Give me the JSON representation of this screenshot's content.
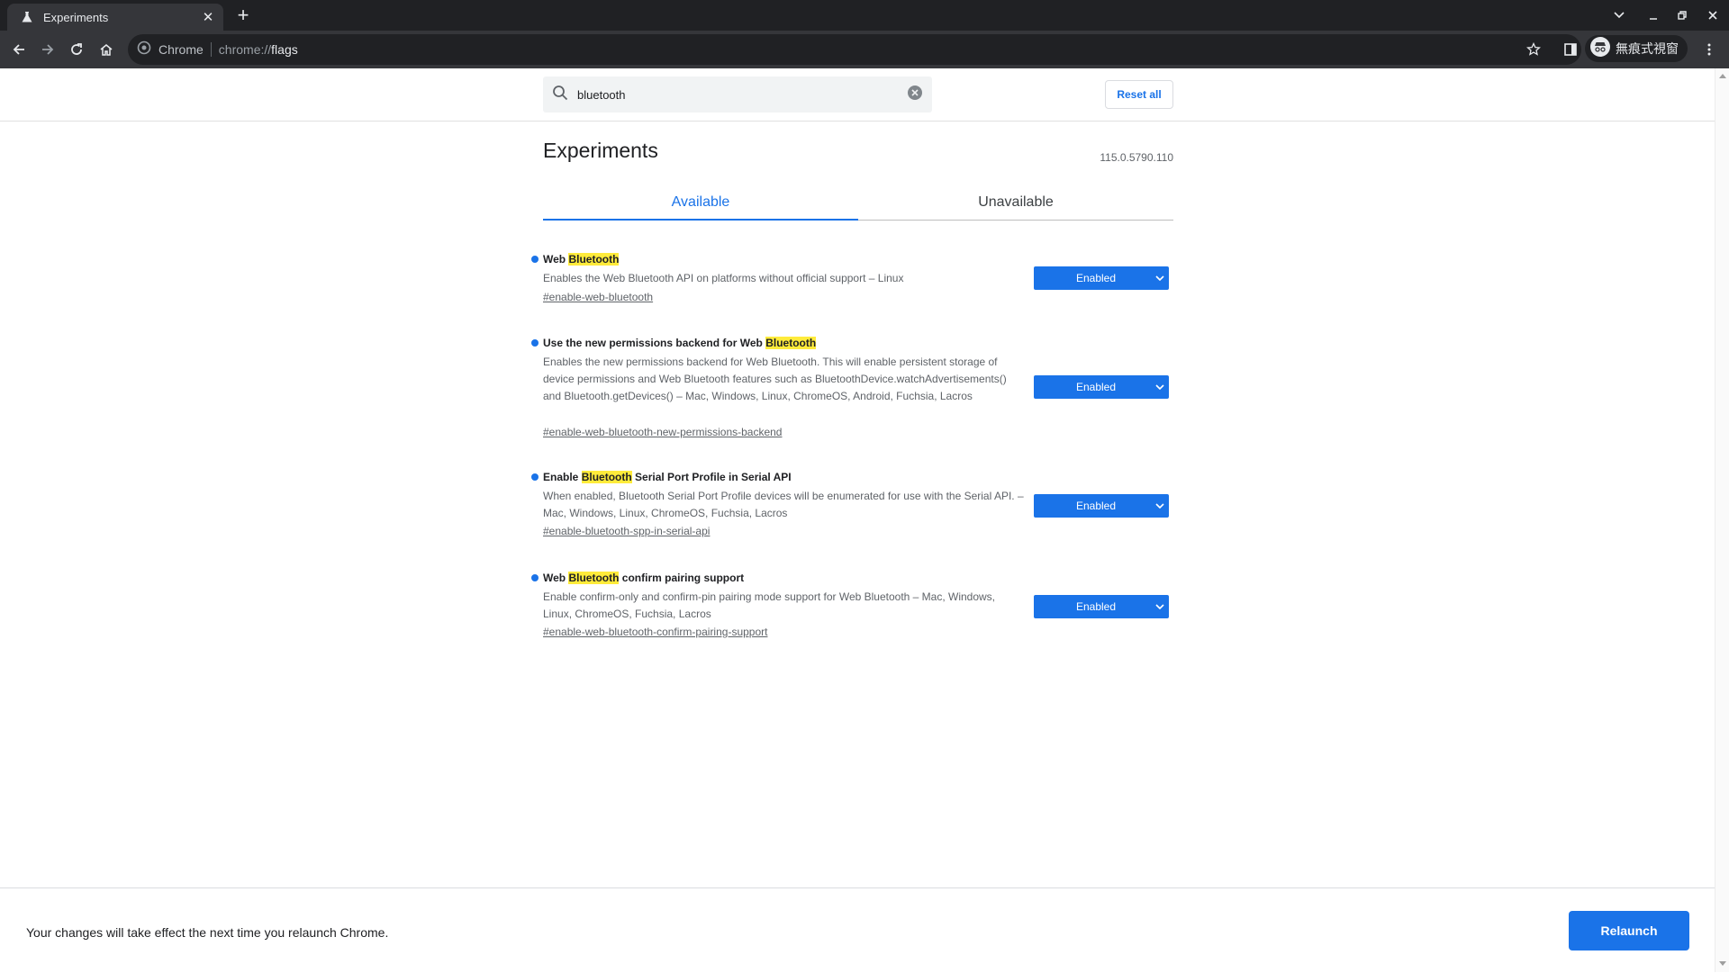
{
  "browser": {
    "tab_title": "Experiments",
    "tab_close": "✕",
    "new_tab": "+",
    "omnibox_site": "Chrome",
    "omnibox_scheme": "chrome://",
    "omnibox_path": "flags",
    "profile_label": "無痕式視窗"
  },
  "search": {
    "value": "bluetooth",
    "reset_label": "Reset all"
  },
  "page": {
    "heading": "Experiments",
    "version": "115.0.5790.110",
    "tabs": [
      {
        "label": "Available",
        "active": true
      },
      {
        "label": "Unavailable",
        "active": false
      }
    ]
  },
  "experiments": [
    {
      "title_pre": "Web ",
      "title_hl": "Bluetooth",
      "title_post": "",
      "description": "Enables the Web Bluetooth API on platforms without official support – Linux",
      "link": "#enable-web-bluetooth",
      "state": "Enabled"
    },
    {
      "title_pre": "Use the new permissions backend for Web ",
      "title_hl": "Bluetooth",
      "title_post": "",
      "description": "Enables the new permissions backend for Web Bluetooth. This will enable persistent storage of device permissions and Web Bluetooth features such as BluetoothDevice.watchAdvertisements() and Bluetooth.getDevices() – Mac, Windows, Linux, ChromeOS, Android, Fuchsia, Lacros",
      "link": "#enable-web-bluetooth-new-permissions-backend",
      "state": "Enabled"
    },
    {
      "title_pre": "Enable ",
      "title_hl": "Bluetooth",
      "title_post": " Serial Port Profile in Serial API",
      "description": "When enabled, Bluetooth Serial Port Profile devices will be enumerated for use with the Serial API. – Mac, Windows, Linux, ChromeOS, Fuchsia, Lacros",
      "link": "#enable-bluetooth-spp-in-serial-api",
      "state": "Enabled"
    },
    {
      "title_pre": "Web ",
      "title_hl": "Bluetooth",
      "title_post": " confirm pairing support",
      "description": "Enable confirm-only and confirm-pin pairing mode support for Web Bluetooth – Mac, Windows, Linux, ChromeOS, Fuchsia, Lacros",
      "link": "#enable-web-bluetooth-confirm-pairing-support",
      "state": "Enabled"
    }
  ],
  "footer": {
    "message": "Your changes will take effect the next time you relaunch Chrome.",
    "relaunch_label": "Relaunch"
  },
  "colors": {
    "accent": "#1a73e8",
    "highlight": "#ffeb3b",
    "frame": "#202124",
    "toolbar": "#35363a"
  }
}
